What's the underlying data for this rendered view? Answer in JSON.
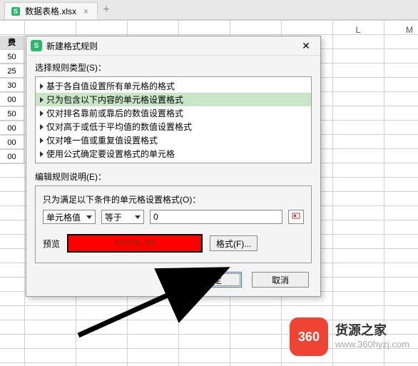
{
  "tab": {
    "filename": "数据表格.xlsx"
  },
  "columns": {
    "L": "L",
    "M": "M"
  },
  "left_col": {
    "header": "费",
    "cells": [
      "50",
      "25",
      "30",
      "00",
      "50",
      "00",
      "00",
      "00"
    ]
  },
  "dialog": {
    "title": "新建格式规则",
    "section_label": "选择规则类型(S)：",
    "rules": [
      "基于各自值设置所有单元格的格式",
      "只为包含以下内容的单元格设置格式",
      "仅对排名靠前或靠后的数值设置格式",
      "仅对高于或低于平均值的数值设置格式",
      "仅对唯一值或重复值设置格式",
      "使用公式确定要设置格式的单元格"
    ],
    "selected_index": 1,
    "edit_label": "编辑规则说明(E)：",
    "condition_title": "只为满足以下条件的单元格设置格式(O)：",
    "combo1": "单元格值",
    "combo2": "等于",
    "value_input": "0",
    "preview_label": "预览",
    "preview_text": "42370.00",
    "format_btn": "格式(F)...",
    "ok": "确定",
    "cancel": "取消"
  },
  "watermark": {
    "logo": "360",
    "title": "货源之家",
    "url": "www.360hyzj.com"
  }
}
